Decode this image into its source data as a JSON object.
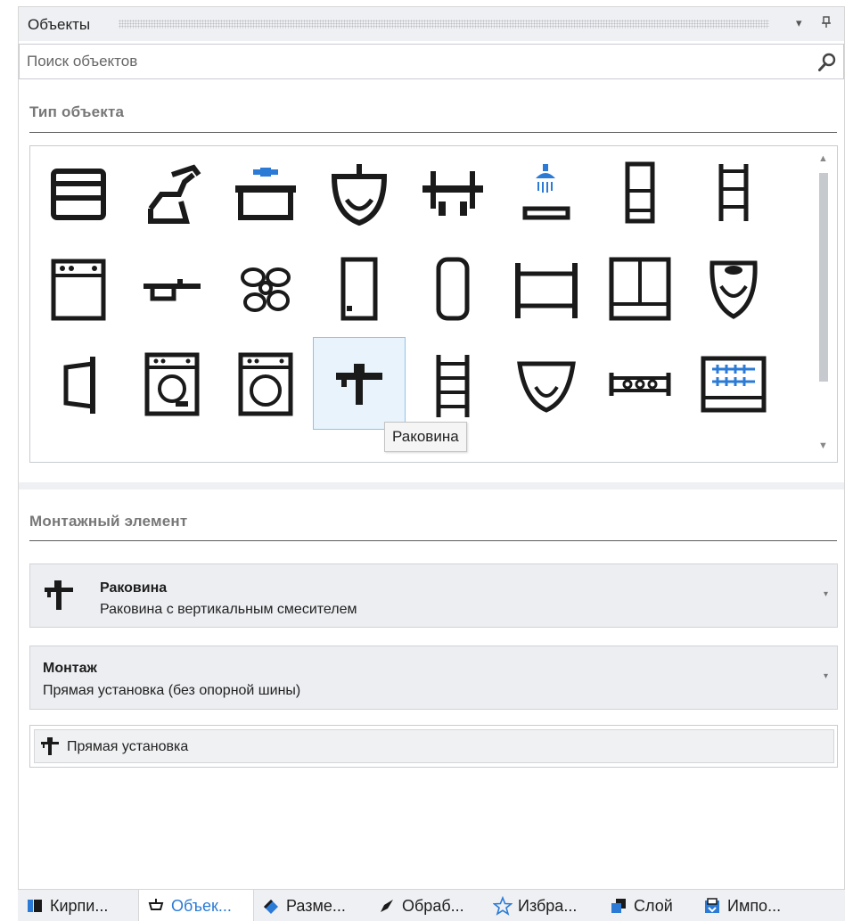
{
  "panel": {
    "title": "Объекты",
    "menu_glyph": "▾",
    "pin_glyph": "ⴲ"
  },
  "search": {
    "placeholder": "Поиск объектов",
    "icon": "search-icon"
  },
  "object_type": {
    "heading": "Тип объекта",
    "icons": [
      [
        "bathtub-top",
        "wall-faucet",
        "bathtub-tap",
        "urinal-front",
        "double-washbasin",
        "shower",
        "cabinet-tall",
        "shelf-rack"
      ],
      [
        "oven",
        "sink-drain",
        "fan",
        "door",
        "bath-oval",
        "bed-frame",
        "wardrobe",
        "toilet-front"
      ],
      [
        "wall-washbasin",
        "washing-machine",
        "dryer",
        "washbasin",
        "towel-radiator",
        "urinal",
        "radiator-low",
        "heating-panel"
      ]
    ],
    "selected": "washbasin",
    "tooltip": "Раковина",
    "scroll_up": "▲",
    "scroll_down": "▼"
  },
  "mount_element": {
    "heading": "Монтажный элемент",
    "type_title": "Раковина",
    "type_sub": "Раковина с вертикальным смесителем",
    "mount_title": "Монтаж",
    "mount_sub": "Прямая установка (без опорной шины)",
    "dropdown_glyph": "▾",
    "list_item": "Прямая установка"
  },
  "tabs": [
    {
      "label": "Кирпи...",
      "icon": "brick-icon"
    },
    {
      "label": "Объек...",
      "icon": "object-icon",
      "active": true
    },
    {
      "label": "Разме...",
      "icon": "dimension-icon"
    },
    {
      "label": "Обраб...",
      "icon": "brush-icon"
    },
    {
      "label": "Избра...",
      "icon": "star-icon"
    },
    {
      "label": "Слой",
      "icon": "layer-icon"
    },
    {
      "label": "Импо...",
      "icon": "import-icon"
    }
  ],
  "colors": {
    "accent": "#2b7bd6",
    "selection_bg": "#e8f3fb",
    "icon": "#1a1a1a"
  }
}
